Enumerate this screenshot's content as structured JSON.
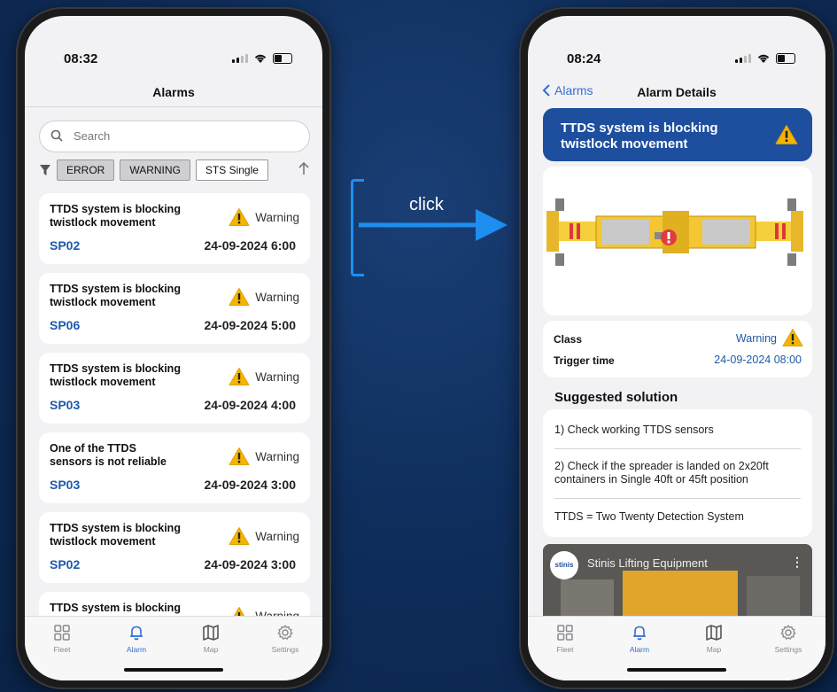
{
  "left_phone": {
    "time": "08:32",
    "nav_title": "Alarms",
    "search": {
      "placeholder": "Search"
    },
    "filters": [
      {
        "label": "ERROR",
        "active": true
      },
      {
        "label": "WARNING",
        "active": true
      },
      {
        "label": "STS Single",
        "active": false
      }
    ],
    "alarms": [
      {
        "title": "TTDS system is blocking twistlock movement",
        "severity": "Warning",
        "code": "SP02",
        "datetime": "24-09-2024 6:00"
      },
      {
        "title": "TTDS system is blocking twistlock movement",
        "severity": "Warning",
        "code": "SP06",
        "datetime": "24-09-2024 5:00"
      },
      {
        "title": "TTDS system is blocking twistlock movement",
        "severity": "Warning",
        "code": "SP03",
        "datetime": "24-09-2024 4:00"
      },
      {
        "title": "One of the TTDS sensors is not reliable",
        "severity": "Warning",
        "code": "SP03",
        "datetime": "24-09-2024 3:00"
      },
      {
        "title": "TTDS system is blocking twistlock movement",
        "severity": "Warning",
        "code": "SP02",
        "datetime": "24-09-2024 3:00"
      },
      {
        "title": "TTDS system is blocking",
        "severity": "Warning",
        "code": "",
        "datetime": ""
      }
    ],
    "tabs": [
      {
        "label": "Fleet",
        "icon": "grid-icon"
      },
      {
        "label": "Alarm",
        "icon": "bell-icon"
      },
      {
        "label": "Map",
        "icon": "map-icon"
      },
      {
        "label": "Settings",
        "icon": "gear-icon"
      }
    ],
    "active_tab": "Alarm"
  },
  "arrow": {
    "label": "click",
    "color": "#1e8ef0"
  },
  "right_phone": {
    "time": "08:24",
    "back_label": "Alarms",
    "nav_title": "Alarm Details",
    "banner_title": "TTDS system is blocking twistlock movement",
    "class_label": "Class",
    "class_value": "Warning",
    "trigger_label": "Trigger time",
    "trigger_value": "24-09-2024 08:00",
    "section_title": "Suggested solution",
    "solutions": [
      "1) Check working TTDS sensors",
      "2) Check if the spreader is landed on 2x20ft containers in Single 40ft or 45ft position",
      "TTDS = Two Twenty Detection System"
    ],
    "video": {
      "channel_logo": "stinis",
      "title": "Stinis Lifting Equipment"
    },
    "tabs": [
      {
        "label": "Fleet",
        "icon": "grid-icon"
      },
      {
        "label": "Alarm",
        "icon": "bell-icon"
      },
      {
        "label": "Map",
        "icon": "map-icon"
      },
      {
        "label": "Settings",
        "icon": "gear-icon"
      }
    ],
    "active_tab": "Alarm"
  },
  "colors": {
    "accent": "#1e5aa8",
    "banner": "#1e4e9e",
    "warning": "#f5b400",
    "background": "#0f2e5c"
  }
}
